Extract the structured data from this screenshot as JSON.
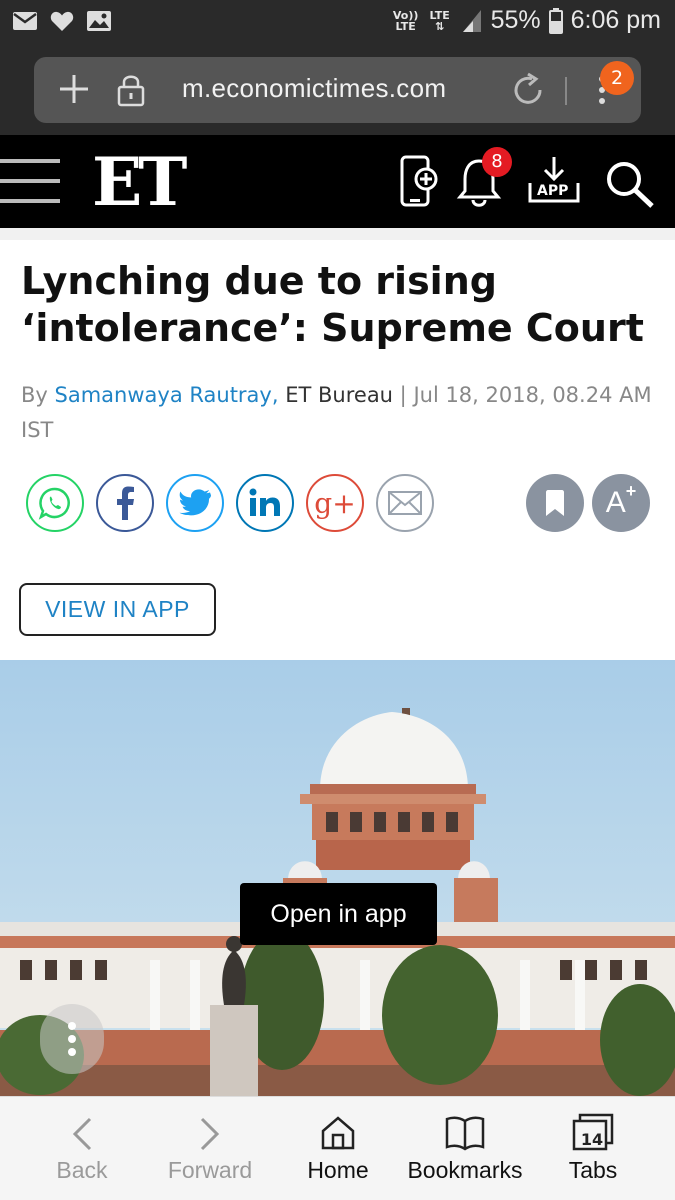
{
  "status_bar": {
    "icons": [
      "mail-icon",
      "heart-icon",
      "image-icon",
      "volte-icon",
      "lte-icon",
      "signal-icon",
      "battery-icon"
    ],
    "volte_label": "Vo)) LTE",
    "lte_label": "LTE",
    "battery": "55%",
    "time": "6:06 pm"
  },
  "browser": {
    "url": "m.economictimes.com",
    "tabs_badge": "2"
  },
  "header": {
    "logo": "ET",
    "notification_count": "8",
    "app_label": "APP"
  },
  "article": {
    "headline": "Lynching due to rising ‘intolerance’: Supreme Court",
    "by_prefix": "By",
    "author": "Samanwaya Rautray",
    "author_suffix": ",",
    "bureau": "ET Bureau",
    "separator": " | ",
    "date": "Jul 18, 2018, 08.24 AM IST",
    "view_in_app": "VIEW IN APP",
    "open_in_app": "Open in app"
  },
  "share": {
    "google_plus_label": "g+",
    "font_size_label": "A"
  },
  "bottom_nav": {
    "back": "Back",
    "forward": "Forward",
    "home": "Home",
    "bookmarks": "Bookmarks",
    "tabs": "Tabs",
    "tabs_count": "14"
  },
  "colors": {
    "link_blue": "#1f83c5",
    "whatsapp": "#25d366",
    "facebook": "#3b5998",
    "twitter": "#1da1f2",
    "linkedin": "#0077b5",
    "google_plus": "#dd4b39",
    "mail": "#9aa3ae",
    "badge_orange": "#f0641e",
    "badge_red": "#e41b23"
  }
}
